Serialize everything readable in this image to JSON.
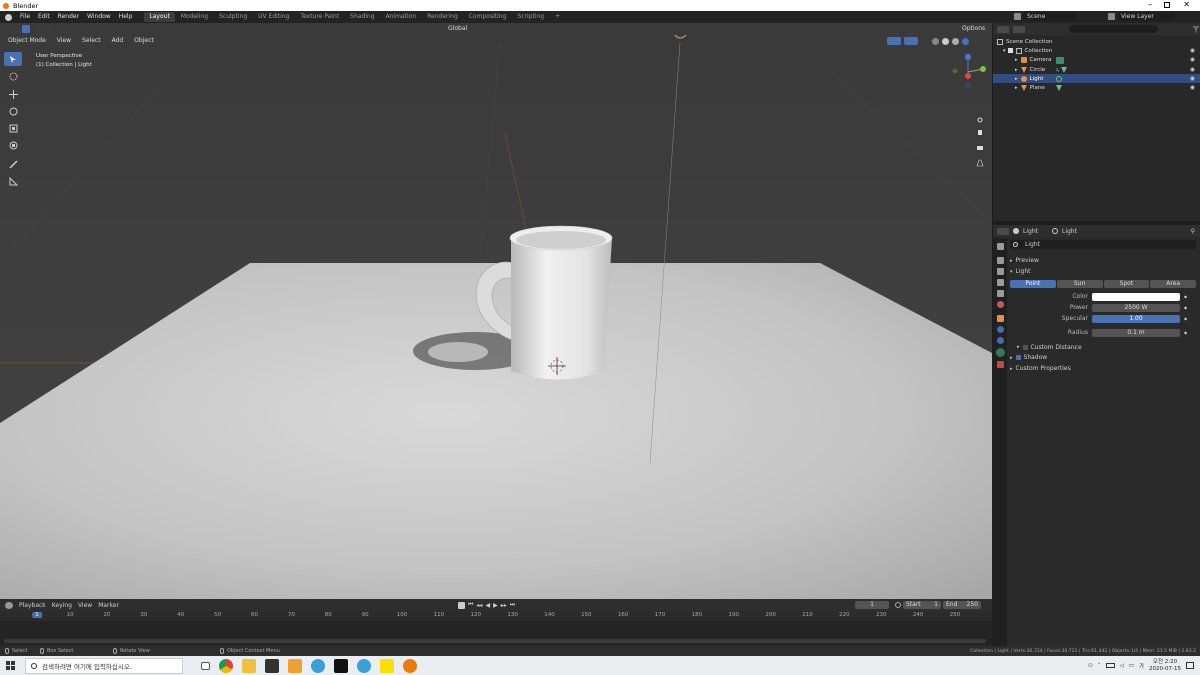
{
  "window": {
    "title": "Blender"
  },
  "menu": [
    "File",
    "Edit",
    "Render",
    "Window",
    "Help"
  ],
  "workspaces": [
    "Layout",
    "Modeling",
    "Sculpting",
    "UV Editing",
    "Texture Paint",
    "Shading",
    "Animation",
    "Rendering",
    "Compositing",
    "Scripting"
  ],
  "scene": {
    "name": "Scene",
    "view_layer": "View Layer"
  },
  "viewport": {
    "mode": "Object Mode",
    "menus": [
      "View",
      "Select",
      "Add",
      "Object"
    ],
    "orientation": "Global",
    "options": "Options",
    "overlay_line1": "User Perspective",
    "overlay_line2": "(1) Collection | Light"
  },
  "outliner": {
    "root": "Scene Collection",
    "collection": "Collection",
    "items": [
      {
        "name": "Camera",
        "icon": "camera-icon",
        "selected": false
      },
      {
        "name": "Circle",
        "icon": "mesh-icon",
        "selected": false
      },
      {
        "name": "Light",
        "icon": "light-icon",
        "selected": true
      },
      {
        "name": "Plane",
        "icon": "mesh-icon",
        "selected": false
      }
    ]
  },
  "properties": {
    "breadcrumb_object": "Light",
    "breadcrumb_data": "Light",
    "datablock": "Light",
    "preview": "Preview",
    "section": "Light",
    "types": [
      "Point",
      "Sun",
      "Spot",
      "Area"
    ],
    "active_type": "Point",
    "color_label": "Color",
    "power_label": "Power",
    "power_value": "2500 W",
    "specular_label": "Specular",
    "specular_value": "1.00",
    "radius_label": "Radius",
    "radius_value": "0.1 m",
    "custom_distance": "Custom Distance",
    "shadow": "Shadow",
    "custom_properties": "Custom Properties"
  },
  "timeline": {
    "menus": [
      "Playback",
      "Keying",
      "View",
      "Marker"
    ],
    "current_frame": "1",
    "start_label": "Start",
    "start": "1",
    "end_label": "End",
    "end": "250",
    "ticks": [
      "1",
      "10",
      "20",
      "30",
      "40",
      "50",
      "60",
      "70",
      "80",
      "90",
      "100",
      "110",
      "120",
      "130",
      "140",
      "150",
      "160",
      "170",
      "180",
      "190",
      "200",
      "210",
      "220",
      "230",
      "240",
      "250"
    ]
  },
  "statusbar": {
    "select": "Select",
    "box_select": "Box Select",
    "rotate_view": "Rotate View",
    "context_menu": "Object Context Menu",
    "stats": "Collection | Light | Verts:30,724 | Faces:30,721 | Tris:61,442 | Objects:1/4 | Mem: 23.5 MiB | 2.83.2"
  },
  "taskbar": {
    "search_placeholder": "검색하려면 여기에 입력하십시오.",
    "time": "오전 2:20",
    "date": "2020-07-15"
  },
  "colors": {
    "accent": "#4772b3",
    "selection": "#334d80"
  }
}
